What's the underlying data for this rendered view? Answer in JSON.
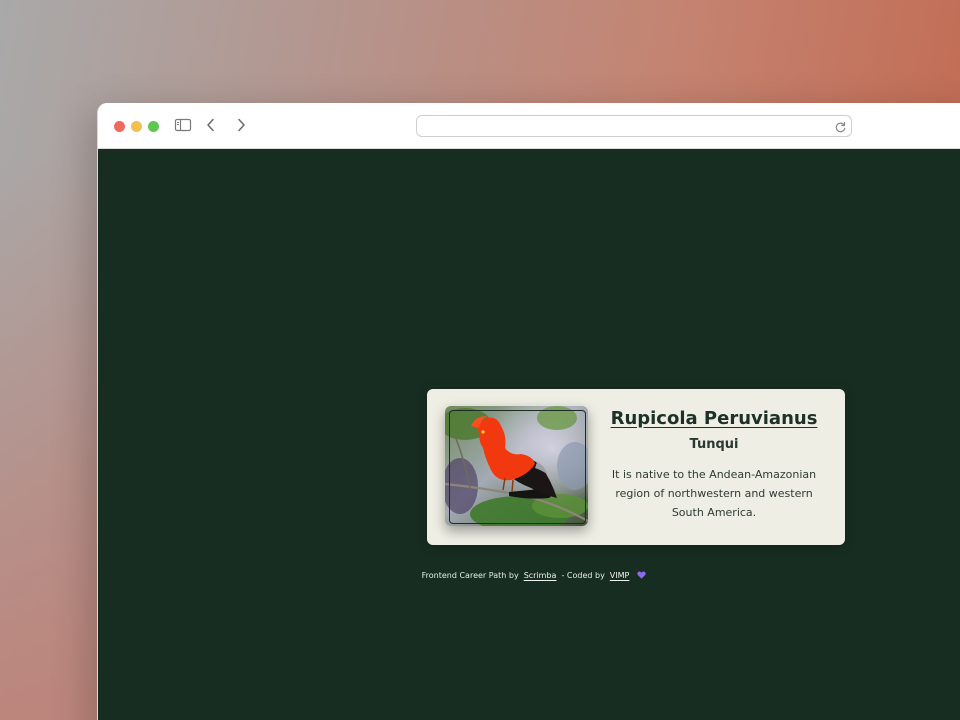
{
  "browser": {
    "address_value": "",
    "icons": [
      "sidebar-icon",
      "chevron-left-icon",
      "chevron-right-icon",
      "reload-icon"
    ]
  },
  "card": {
    "title": "Rupicola Peruvianus",
    "subtitle": "Tunqui",
    "description": "It is native to the Andean-Amazonian region of northwestern and western South America.",
    "image_icon": "bird-photo"
  },
  "footer": {
    "prefix": "Frontend Career Path by",
    "link1": "Scrimba",
    "middle": "- Coded by",
    "link2": "VIMP",
    "icon": "heart-icon"
  },
  "colors": {
    "page_background": "#182d21",
    "card_background": "#eeeee4",
    "bird": "#f2380f",
    "heart": "#8b6cf0"
  }
}
